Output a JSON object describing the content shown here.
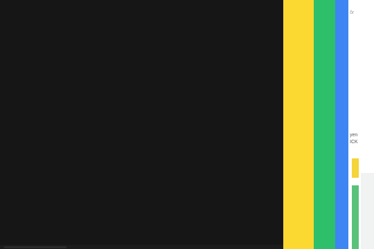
{
  "colors": {
    "main_panel": "#161616",
    "stripe_yellow": "#fcd931",
    "stripe_green": "#2ebf6a",
    "stripe_blue": "#3d85f2",
    "side_panel": "#ffffff"
  },
  "side_panel": {
    "top_text": "ôr",
    "mid_text_1": "yen",
    "mid_text_2": "ICK"
  }
}
